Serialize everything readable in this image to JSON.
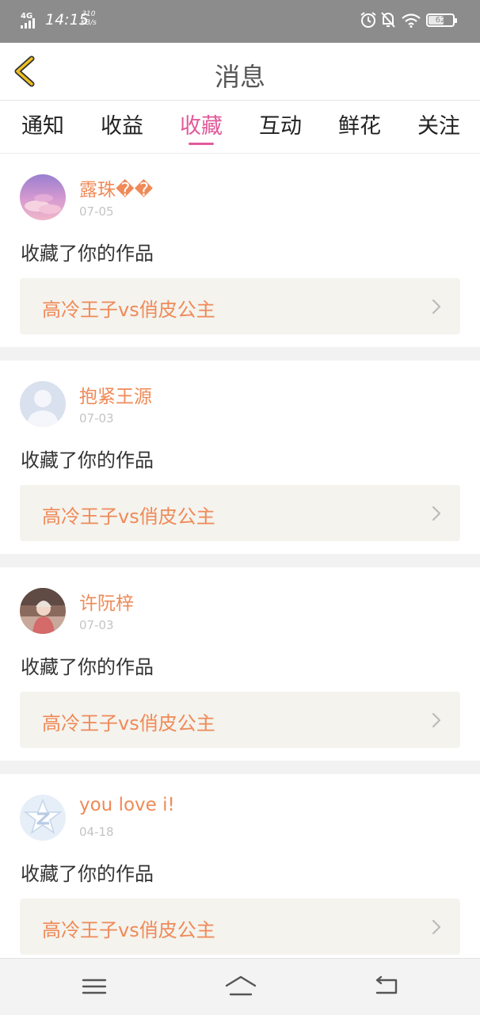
{
  "status_bar": {
    "network": "4G",
    "time": "14:15",
    "speed_value": "310",
    "speed_unit": "KB/s",
    "battery_level": 62,
    "battery_text": "62",
    "icons": [
      "signal-icon",
      "alarm-icon",
      "mute-icon",
      "wifi-icon",
      "battery-icon"
    ]
  },
  "header": {
    "back_icon": "chevron-left-icon",
    "title": "消息"
  },
  "tabs": [
    {
      "label": "通知",
      "active": false
    },
    {
      "label": "收益",
      "active": false
    },
    {
      "label": "收藏",
      "active": true
    },
    {
      "label": "互动",
      "active": false
    },
    {
      "label": "鲜花",
      "active": false
    },
    {
      "label": "关注",
      "active": false
    }
  ],
  "messages": [
    {
      "username": "露珠��",
      "date": "07-05",
      "action": "收藏了你的作品",
      "work_title": "高冷王子vs俏皮公主",
      "avatar": "sky-clouds-avatar"
    },
    {
      "username": "抱紧王源",
      "date": "07-03",
      "action": "收藏了你的作品",
      "work_title": "高冷王子vs俏皮公主",
      "avatar": "default-person-avatar"
    },
    {
      "username": "许阮梓",
      "date": "07-03",
      "action": "收藏了你的作品",
      "work_title": "高冷王子vs俏皮公主",
      "avatar": "photo-girl-avatar"
    },
    {
      "username": "you love i!",
      "date": "04-18",
      "action": "收藏了你的作品",
      "work_title": "高冷王子vs俏皮公主",
      "avatar": "qq-star-avatar"
    }
  ],
  "nav_bar": {
    "icons": [
      "menu-icon",
      "home-icon",
      "back-icon"
    ]
  },
  "colors": {
    "accent": "#e25a9a",
    "username": "#ef8a58",
    "status_bar": "#8c8c8c",
    "back_arrow": "#f0c020"
  }
}
